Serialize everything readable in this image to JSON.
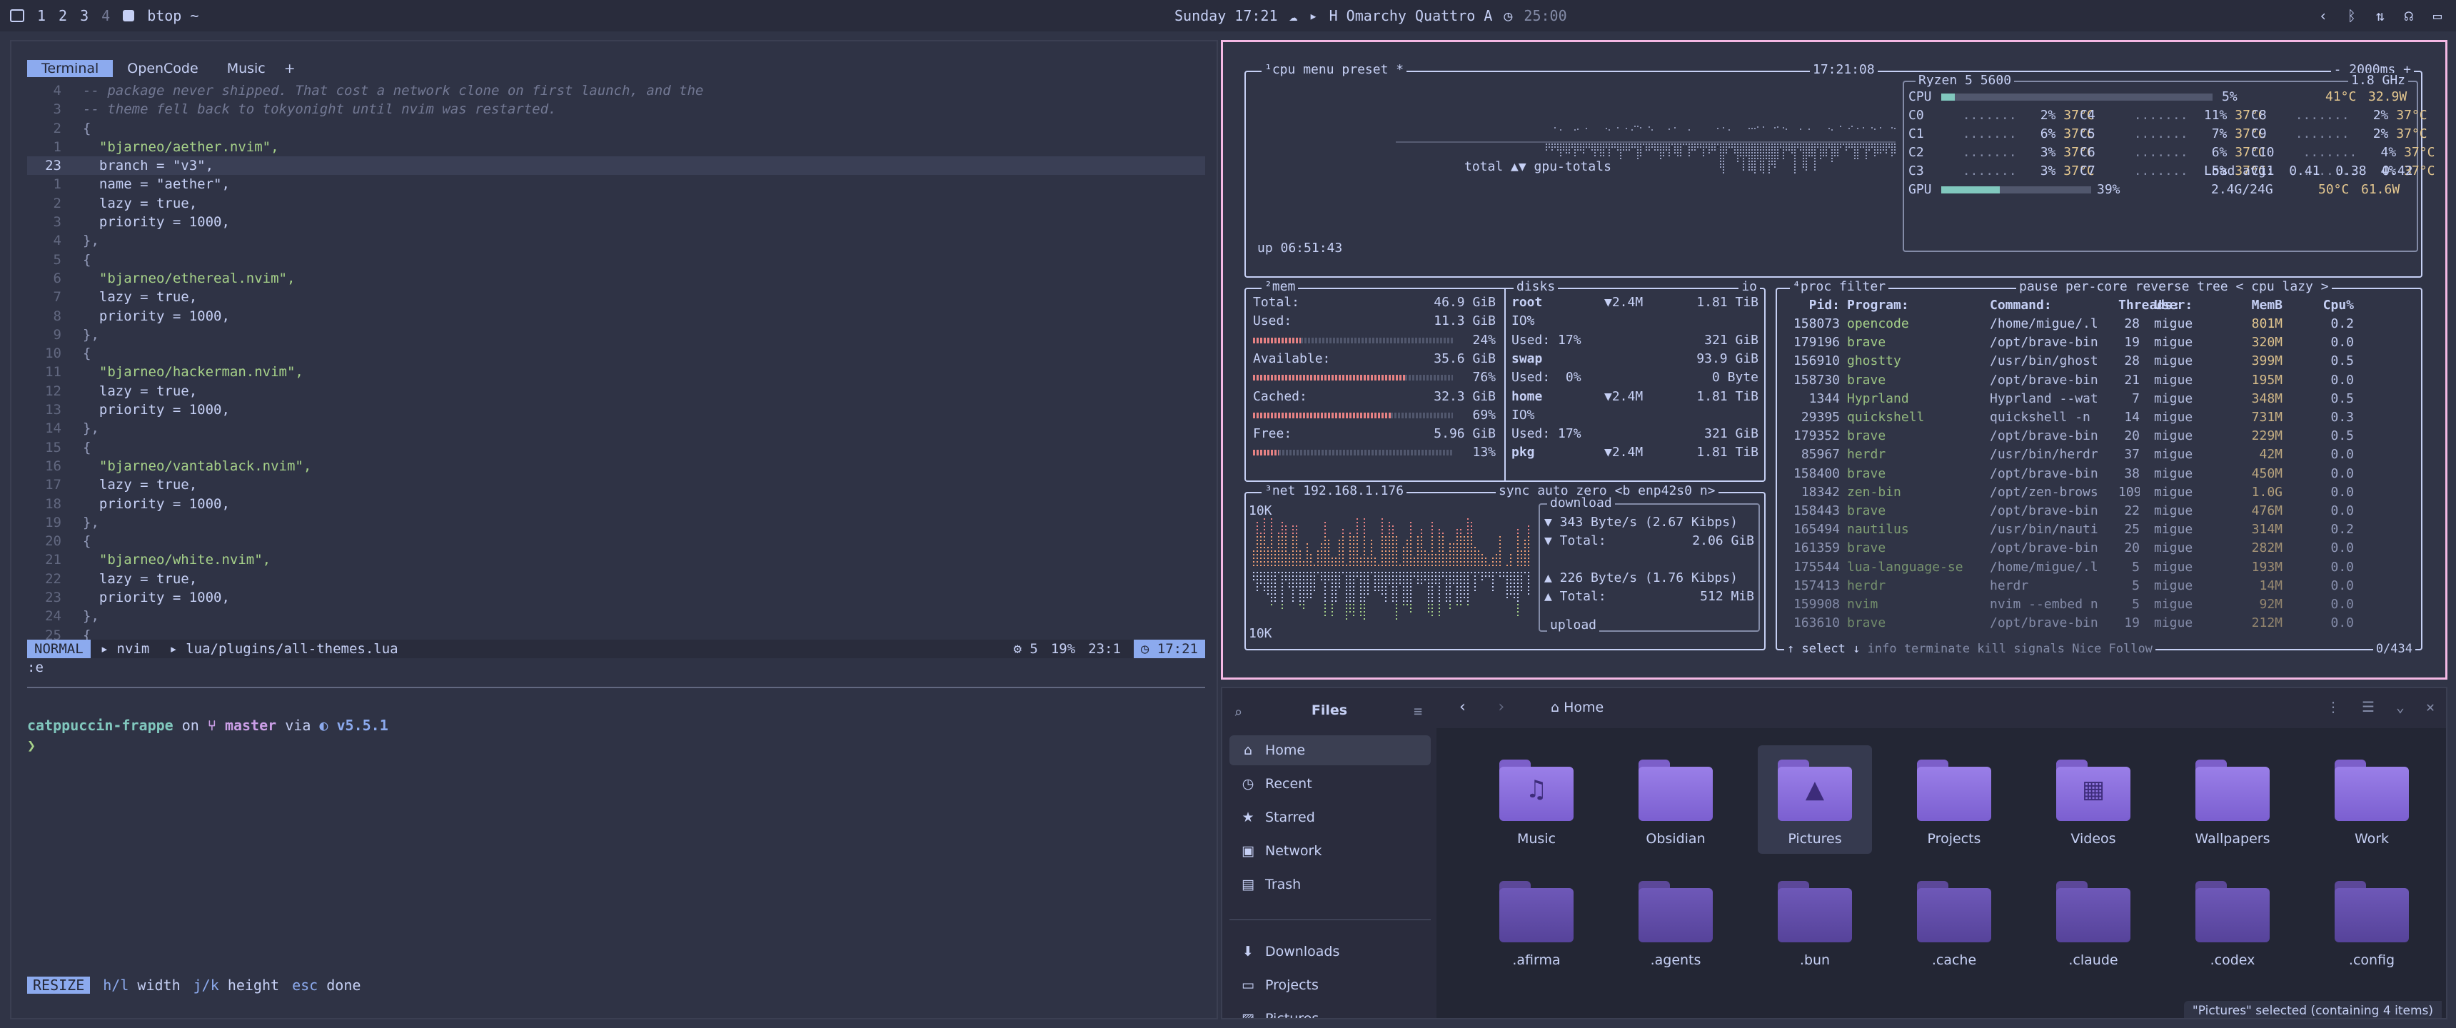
{
  "topbar": {
    "workspaces": [
      "1",
      "2",
      "3",
      "4"
    ],
    "app_title": "btop ~",
    "clock": "Sunday 17:21",
    "media": "H Omarchy Quattro A",
    "timer": "25:00"
  },
  "terminal": {
    "tabs": [
      "Terminal",
      "OpenCode",
      "Music",
      "+"
    ],
    "code_lines": [
      {
        "n": "4",
        "t": "-- package never shipped. That cost a network clone on first launch, and the",
        "c": "cmt"
      },
      {
        "n": "3",
        "t": "-- theme fell back to tokyonight until nvim was restarted.",
        "c": "cmt"
      },
      {
        "n": "2",
        "t": "{",
        "c": "pun"
      },
      {
        "n": "1",
        "t": "  \"bjarneo/aether.nvim\",",
        "c": "str"
      },
      {
        "n": "23",
        "t": "  branch = \"v3\",",
        "c": "mix",
        "cur": true
      },
      {
        "n": "1",
        "t": "  name = \"aether\",",
        "c": "mix"
      },
      {
        "n": "2",
        "t": "  lazy = true,",
        "c": "kw"
      },
      {
        "n": "3",
        "t": "  priority = 1000,",
        "c": "numl"
      },
      {
        "n": "4",
        "t": "},",
        "c": "pun"
      },
      {
        "n": "5",
        "t": "{",
        "c": "pun"
      },
      {
        "n": "6",
        "t": "  \"bjarneo/ethereal.nvim\",",
        "c": "str"
      },
      {
        "n": "7",
        "t": "  lazy = true,",
        "c": "kw"
      },
      {
        "n": "8",
        "t": "  priority = 1000,",
        "c": "numl"
      },
      {
        "n": "9",
        "t": "},",
        "c": "pun"
      },
      {
        "n": "10",
        "t": "{",
        "c": "pun"
      },
      {
        "n": "11",
        "t": "  \"bjarneo/hackerman.nvim\",",
        "c": "str"
      },
      {
        "n": "12",
        "t": "  lazy = true,",
        "c": "kw"
      },
      {
        "n": "13",
        "t": "  priority = 1000,",
        "c": "numl"
      },
      {
        "n": "14",
        "t": "},",
        "c": "pun"
      },
      {
        "n": "15",
        "t": "{",
        "c": "pun"
      },
      {
        "n": "16",
        "t": "  \"bjarneo/vantablack.nvim\",",
        "c": "str"
      },
      {
        "n": "17",
        "t": "  lazy = true,",
        "c": "kw"
      },
      {
        "n": "18",
        "t": "  priority = 1000,",
        "c": "numl"
      },
      {
        "n": "19",
        "t": "},",
        "c": "pun"
      },
      {
        "n": "20",
        "t": "{",
        "c": "pun"
      },
      {
        "n": "21",
        "t": "  \"bjarneo/white.nvim\",",
        "c": "str"
      },
      {
        "n": "22",
        "t": "  lazy = true,",
        "c": "kw"
      },
      {
        "n": "23",
        "t": "  priority = 1000,",
        "c": "numl"
      },
      {
        "n": "24",
        "t": "},",
        "c": "pun"
      },
      {
        "n": "25",
        "t": "{",
        "c": "pun"
      }
    ],
    "status": {
      "mode": "NORMAL",
      "branch": "nvim",
      "file": "lua/plugins/all-themes.lua",
      "lsp_count": "5",
      "percent": "19%",
      "position": "23:1",
      "time": "17:21"
    },
    "cmdline": ":e",
    "prompt": {
      "dir": "catppuccin-frappe",
      "on": "on",
      "branch": "master",
      "via": "via",
      "lua": "v5.5.1",
      "caret": "❯"
    },
    "resize": {
      "badge": "RESIZE",
      "k1": "h/l",
      "l1": "width",
      "k2": "j/k",
      "l2": "height",
      "k3": "esc",
      "l3": "done"
    }
  },
  "btop": {
    "cpu_header": {
      "label": "¹cpu",
      "menu": "menu",
      "preset": "preset *",
      "time": "17:21:08",
      "rate": "- 2000ms +"
    },
    "cpu_name": "Ryzen 5 5600",
    "cpu_freq": "1.8 GHz",
    "cpu_total": {
      "label": "CPU",
      "pct": "5%",
      "temp": "41°C",
      "watt": "32.9W",
      "fill": 0.05
    },
    "cores": [
      {
        "n": "C0",
        "p": "2%",
        "t": "37°C"
      },
      {
        "n": "C4",
        "p": "11%",
        "t": "37°C"
      },
      {
        "n": "C8",
        "p": "2%",
        "t": "37°C"
      },
      {
        "n": "C1",
        "p": "6%",
        "t": "37°C"
      },
      {
        "n": "C5",
        "p": "7%",
        "t": "37°C"
      },
      {
        "n": "C9",
        "p": "2%",
        "t": "37°C"
      },
      {
        "n": "C2",
        "p": "3%",
        "t": "37°C"
      },
      {
        "n": "C6",
        "p": "6%",
        "t": "37°C"
      },
      {
        "n": "C10",
        "p": "4%",
        "t": "37°C"
      },
      {
        "n": "C3",
        "p": "3%",
        "t": "37°C"
      },
      {
        "n": "C7",
        "p": "5%",
        "t": "37°C"
      },
      {
        "n": "C11",
        "p": "4%",
        "t": "37°C"
      }
    ],
    "load_avg": "Load avg:  0.41  0.38  0.42",
    "gpu": {
      "label": "GPU",
      "pct": "39%",
      "mem": "2.4G/24G",
      "temp": "50°C",
      "watt": "61.6W",
      "fill": 0.39
    },
    "graph_label": "total ▲▼ gpu-totals",
    "uptime": "up 06:51:43",
    "mem": {
      "label": "²mem",
      "rows": [
        {
          "k": "Total:",
          "v": "46.9 GiB"
        },
        {
          "k": "Used:",
          "v": "11.3 GiB"
        },
        {
          "k": "",
          "v": "24%"
        },
        {
          "k": "Available:",
          "v": "35.6 GiB"
        },
        {
          "k": "",
          "v": "76%"
        },
        {
          "k": "Cached:",
          "v": "32.3 GiB"
        },
        {
          "k": "",
          "v": "69%"
        },
        {
          "k": "Free:",
          "v": "5.96 GiB"
        },
        {
          "k": "",
          "v": "13%"
        }
      ]
    },
    "disks": {
      "label": "disks",
      "io": "io",
      "rows": [
        {
          "k": "root",
          "m": "▼2.4M",
          "v": "1.81 TiB"
        },
        {
          "k": "IO%",
          "m": "",
          "v": ""
        },
        {
          "k": "Used: 17%",
          "m": "",
          "v": "321 GiB"
        },
        {
          "k": "swap",
          "m": "",
          "v": "93.9 GiB"
        },
        {
          "k": "Used:  0%",
          "m": "",
          "v": "0 Byte"
        },
        {
          "k": "home",
          "m": "▼2.4M",
          "v": "1.81 TiB"
        },
        {
          "k": "IO%",
          "m": "",
          "v": ""
        },
        {
          "k": "Used: 17%",
          "m": "",
          "v": "321 GiB"
        },
        {
          "k": "pkg",
          "m": "▼2.4M",
          "v": "1.81 TiB"
        }
      ]
    },
    "net": {
      "label": "³net",
      "ip": "192.168.1.176",
      "sync": "sync",
      "auto": "auto",
      "zero": "zero",
      "iface": "<b enp42s0 n>",
      "scale_top": "10K",
      "scale_bottom": "10K",
      "download": "download",
      "dl_rate": "▼ 343 Byte/s (2.67 Kibps)",
      "dl_total_k": "▼ Total:",
      "dl_total_v": "2.06 GiB",
      "ul_rate": "▲ 226 Byte/s (1.76 Kibps)",
      "ul_total_k": "▲ Total:",
      "ul_total_v": "512 MiB",
      "upload": "upload"
    },
    "proc": {
      "label": "⁴proc",
      "filter": "filter",
      "pause": "pause",
      "percore": "per-core",
      "reverse": "reverse",
      "tree": "tree",
      "sort": "< cpu lazy >",
      "columns": [
        "Pid:",
        "Program:",
        "Command:",
        "Threads:",
        "User:",
        "MemB",
        "Cpu%"
      ],
      "rows": [
        [
          "158073",
          "opencode",
          "/home/migue/.l",
          "28",
          "migue",
          "801M",
          "0.2"
        ],
        [
          "179196",
          "brave",
          "/opt/brave-bin",
          "19",
          "migue",
          "320M",
          "0.0"
        ],
        [
          "156910",
          "ghostty",
          "/usr/bin/ghost",
          "28",
          "migue",
          "399M",
          "0.5"
        ],
        [
          "158730",
          "brave",
          "/opt/brave-bin",
          "21",
          "migue",
          "195M",
          "0.0"
        ],
        [
          "1344",
          "Hyprland",
          "Hyprland --wat",
          "7",
          "migue",
          "348M",
          "0.5"
        ],
        [
          "29395",
          "quickshell",
          "quickshell -n",
          "14",
          "migue",
          "731M",
          "0.3"
        ],
        [
          "179352",
          "brave",
          "/opt/brave-bin",
          "20",
          "migue",
          "229M",
          "0.5"
        ],
        [
          "85967",
          "herdr",
          "/usr/bin/herdr",
          "37",
          "migue",
          "42M",
          "0.0"
        ],
        [
          "158400",
          "brave",
          "/opt/brave-bin",
          "38",
          "migue",
          "450M",
          "0.0"
        ],
        [
          "18342",
          "zen-bin",
          "/opt/zen-brows",
          "109",
          "migue",
          "1.0G",
          "0.0"
        ],
        [
          "158443",
          "brave",
          "/opt/brave-bin",
          "22",
          "migue",
          "476M",
          "0.0"
        ],
        [
          "165494",
          "nautilus",
          "/usr/bin/nauti",
          "25",
          "migue",
          "314M",
          "0.2"
        ],
        [
          "161359",
          "brave",
          "/opt/brave-bin",
          "20",
          "migue",
          "282M",
          "0.0"
        ],
        [
          "175544",
          "lua-language-se",
          "/home/migue/.l",
          "5",
          "migue",
          "193M",
          "0.0"
        ],
        [
          "157413",
          "herdr",
          "herdr",
          "5",
          "migue",
          "14M",
          "0.0"
        ],
        [
          "159908",
          "nvim",
          "nvim --embed n",
          "5",
          "migue",
          "92M",
          "0.0"
        ],
        [
          "163610",
          "brave",
          "/opt/brave-bin",
          "19",
          "migue",
          "212M",
          "0.0"
        ]
      ],
      "footer_select": "↑ select ↓",
      "footer_info": "info",
      "footer_term": "terminate",
      "footer_kill": "kill",
      "footer_signals": "signals",
      "footer_nice": "Nice",
      "footer_follow": "Follow",
      "count": "0/434"
    }
  },
  "files": {
    "sidebar_title": "Files",
    "location": "Home",
    "sidebar": [
      {
        "label": "Home",
        "icon": "home-icon"
      },
      {
        "label": "Recent",
        "icon": "clock-icon"
      },
      {
        "label": "Starred",
        "icon": "star-icon"
      },
      {
        "label": "Network",
        "icon": "network-icon"
      },
      {
        "label": "Trash",
        "icon": "trash-icon"
      },
      {
        "label": "Downloads",
        "icon": "download-icon"
      },
      {
        "label": "Projects",
        "icon": "folder-icon"
      },
      {
        "label": "Pictures",
        "icon": "image-icon"
      }
    ],
    "folders_row1": [
      {
        "name": "Music",
        "glyph": "♫"
      },
      {
        "name": "Obsidian",
        "glyph": ""
      },
      {
        "name": "Pictures",
        "glyph": "▲"
      },
      {
        "name": "Projects",
        "glyph": ""
      },
      {
        "name": "Videos",
        "glyph": "▦"
      },
      {
        "name": "Wallpapers",
        "glyph": ""
      },
      {
        "name": "Work",
        "glyph": ""
      }
    ],
    "folders_row2": [
      {
        "name": ".afirma"
      },
      {
        "name": ".agents"
      },
      {
        "name": ".bun"
      },
      {
        "name": ".cache"
      },
      {
        "name": ".claude"
      },
      {
        "name": ".codex"
      },
      {
        "name": ".config"
      }
    ],
    "status": "\"Pictures\" selected (containing 4 items)"
  }
}
